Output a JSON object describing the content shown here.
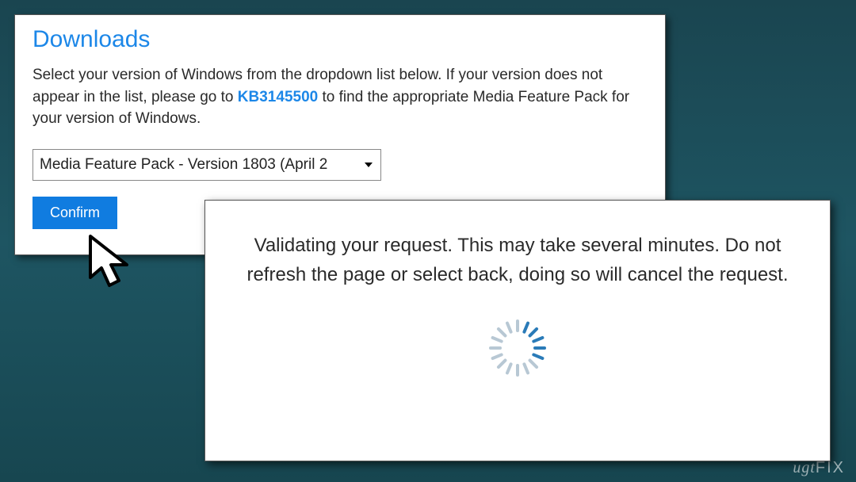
{
  "downloads": {
    "title": "Downloads",
    "description_before": "Select your version of Windows from the dropdown list below. If your version does not appear in the list, please go to ",
    "kb_link_text": "KB3145500",
    "description_after": " to find the appropriate Media Feature Pack for your version of Windows.",
    "select_value": "Media Feature Pack - Version 1803 (April 2",
    "confirm_label": "Confirm"
  },
  "validating": {
    "message": "Validating your request. This may take several minutes. Do not refresh the page or select back, doing so will cancel the request."
  },
  "watermark": {
    "part1": "ug",
    "part2": "t",
    "part3": "FIX"
  },
  "colors": {
    "accent": "#1c87e8",
    "button": "#107ce0"
  }
}
